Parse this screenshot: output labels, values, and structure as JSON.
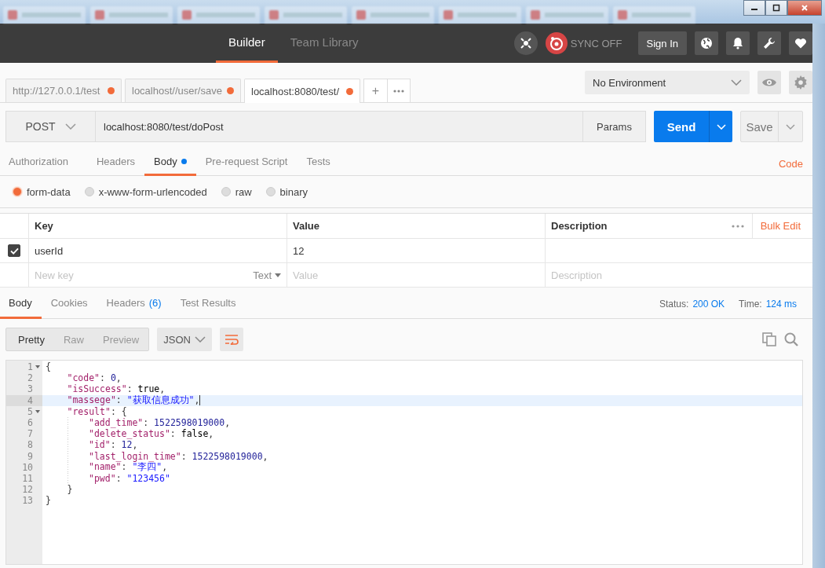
{
  "header": {
    "tabs": [
      {
        "label": "Builder",
        "selected": true
      },
      {
        "label": "Team Library",
        "selected": false
      }
    ],
    "sync": "SYNC OFF",
    "sign_in": "Sign In"
  },
  "request_tabs": [
    {
      "label": "http://127.0.0.1/test",
      "selected": false,
      "unsaved": true
    },
    {
      "label": "localhost//user/save",
      "selected": false,
      "unsaved": true
    },
    {
      "label": "localhost:8080/test/",
      "selected": true,
      "unsaved": true
    }
  ],
  "new_tab": "+",
  "environment": "No Environment",
  "request": {
    "method": "POST",
    "url": "localhost:8080/test/doPost",
    "params": "Params",
    "send": "Send",
    "save": "Save"
  },
  "request_sections": {
    "tabs": [
      {
        "label": "Authorization",
        "selected": false,
        "dot": false
      },
      {
        "label": "Headers",
        "selected": false,
        "dot": false
      },
      {
        "label": "Body",
        "selected": true,
        "dot": true
      },
      {
        "label": "Pre-request Script",
        "selected": false,
        "dot": false
      },
      {
        "label": "Tests",
        "selected": false,
        "dot": false
      }
    ],
    "code": "Code"
  },
  "body_modes": [
    {
      "label": "form-data",
      "selected": true
    },
    {
      "label": "x-www-form-urlencoded",
      "selected": false
    },
    {
      "label": "raw",
      "selected": false
    },
    {
      "label": "binary",
      "selected": false
    }
  ],
  "params_table": {
    "columns": [
      "Key",
      "Value",
      "Description"
    ],
    "bulk_edit": "Bulk Edit",
    "rows": [
      {
        "checked": true,
        "key": "userId",
        "value": "12"
      }
    ],
    "new_row": {
      "key": "New key",
      "type": "Text",
      "value": "Value",
      "description": "Description"
    }
  },
  "response": {
    "tabs": [
      {
        "label": "Body",
        "selected": true
      },
      {
        "label": "Cookies",
        "selected": false
      },
      {
        "label": "Headers",
        "count": "(6)",
        "selected": false
      },
      {
        "label": "Test Results",
        "selected": false
      }
    ],
    "status_label": "Status:",
    "status": "200 OK",
    "time_label": "Time:",
    "time": "124 ms",
    "views": [
      {
        "label": "Pretty",
        "selected": true
      },
      {
        "label": "Raw",
        "selected": false
      },
      {
        "label": "Preview",
        "selected": false
      }
    ],
    "format": "JSON",
    "lines": [
      {
        "number": "1",
        "fold": true,
        "current": false,
        "tokens": [
          {
            "kind": "punct",
            "text": "{"
          }
        ],
        "children": [
          {
            "number": "2",
            "fold": false,
            "current": false,
            "tokens": [
              {
                "kind": "key",
                "text": "\"code\""
              },
              {
                "kind": "punct",
                "text": ": "
              },
              {
                "kind": "number",
                "text": "0"
              },
              {
                "kind": "punct",
                "text": ","
              }
            ]
          },
          {
            "number": "3",
            "fold": false,
            "current": false,
            "tokens": [
              {
                "kind": "key",
                "text": "\"isSuccess\""
              },
              {
                "kind": "punct",
                "text": ": "
              },
              {
                "kind": "bool",
                "text": "true"
              },
              {
                "kind": "punct",
                "text": ","
              }
            ]
          },
          {
            "number": "4",
            "fold": false,
            "current": true,
            "tokens": [
              {
                "kind": "key",
                "text": "\"massege\""
              },
              {
                "kind": "punct",
                "text": ": "
              },
              {
                "kind": "string",
                "text": "\"获取信息成功\""
              },
              {
                "kind": "punct",
                "text": ","
              }
            ]
          },
          {
            "number": "5",
            "fold": true,
            "current": false,
            "tokens": [
              {
                "kind": "key",
                "text": "\"result\""
              },
              {
                "kind": "punct",
                "text": ": {"
              }
            ],
            "children": [
              {
                "number": "6",
                "fold": false,
                "current": false,
                "tokens": [
                  {
                    "kind": "key",
                    "text": "\"add_time\""
                  },
                  {
                    "kind": "punct",
                    "text": ": "
                  },
                  {
                    "kind": "number",
                    "text": "1522598019000"
                  },
                  {
                    "kind": "punct",
                    "text": ","
                  }
                ]
              },
              {
                "number": "7",
                "fold": false,
                "current": false,
                "tokens": [
                  {
                    "kind": "key",
                    "text": "\"delete_status\""
                  },
                  {
                    "kind": "punct",
                    "text": ": "
                  },
                  {
                    "kind": "bool",
                    "text": "false"
                  },
                  {
                    "kind": "punct",
                    "text": ","
                  }
                ]
              },
              {
                "number": "8",
                "fold": false,
                "current": false,
                "tokens": [
                  {
                    "kind": "key",
                    "text": "\"id\""
                  },
                  {
                    "kind": "punct",
                    "text": ": "
                  },
                  {
                    "kind": "number",
                    "text": "12"
                  },
                  {
                    "kind": "punct",
                    "text": ","
                  }
                ]
              },
              {
                "number": "9",
                "fold": false,
                "current": false,
                "tokens": [
                  {
                    "kind": "key",
                    "text": "\"last_login_time\""
                  },
                  {
                    "kind": "punct",
                    "text": ": "
                  },
                  {
                    "kind": "number",
                    "text": "1522598019000"
                  },
                  {
                    "kind": "punct",
                    "text": ","
                  }
                ]
              },
              {
                "number": "10",
                "fold": false,
                "current": false,
                "tokens": [
                  {
                    "kind": "key",
                    "text": "\"name\""
                  },
                  {
                    "kind": "punct",
                    "text": ": "
                  },
                  {
                    "kind": "string",
                    "text": "\"李四\""
                  },
                  {
                    "kind": "punct",
                    "text": ","
                  }
                ]
              },
              {
                "number": "11",
                "fold": false,
                "current": false,
                "tokens": [
                  {
                    "kind": "key",
                    "text": "\"pwd\""
                  },
                  {
                    "kind": "punct",
                    "text": ": "
                  },
                  {
                    "kind": "string",
                    "text": "\"123456\""
                  }
                ]
              }
            ]
          },
          {
            "number": "12",
            "fold": false,
            "current": false,
            "tokens": [
              {
                "kind": "punct",
                "text": "}"
              }
            ]
          }
        ]
      },
      {
        "number": "13",
        "fold": false,
        "current": false,
        "tokens": [
          {
            "kind": "punct",
            "text": "}"
          }
        ]
      }
    ]
  }
}
